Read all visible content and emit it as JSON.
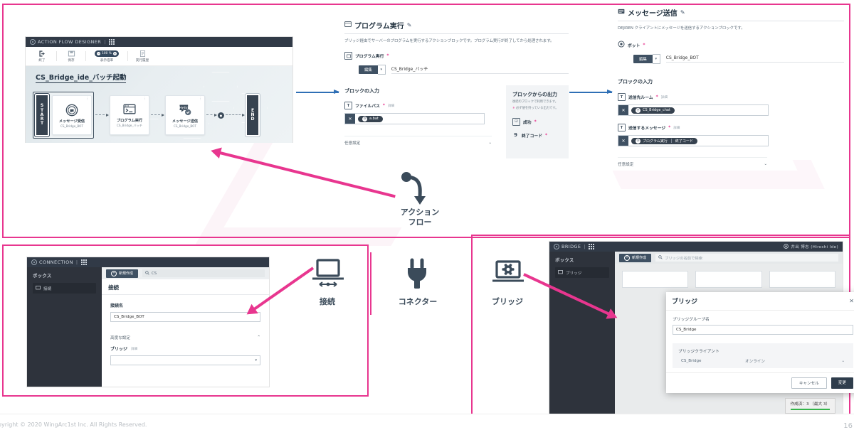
{
  "footer": {
    "copyright": "opyright © 2020 WingArc1st Inc.  All Rights Reserved.",
    "page_number": "16"
  },
  "center_labels": {
    "action_flow_line1": "アクション",
    "action_flow_line2": "フロー",
    "connection": "接続",
    "connector": "コネクター",
    "bridge": "ブリッジ"
  },
  "action_flow_designer": {
    "titlebar": "ACTION FLOW DESIGNER",
    "toolbar": [
      {
        "label": "終了",
        "icon": "exit-icon"
      },
      {
        "label": "保存",
        "icon": "save-icon"
      },
      {
        "label": "表示倍率",
        "icon": "zoom-control",
        "value": "100 %"
      },
      {
        "label": "実行履歴",
        "icon": "history-icon"
      }
    ],
    "flow_title": "CS_Bridge_ide_バッチ起動",
    "start_label": "START",
    "end_label": "END",
    "nodes": [
      {
        "name": "メッセージ受信",
        "sub": "CS_Bridge_BOT",
        "icon": "message-receive-icon"
      },
      {
        "name": "プログラム実行",
        "sub": "CS_Bridge_バッチ",
        "icon": "terminal-icon"
      },
      {
        "name": "メッセージ送信",
        "sub": "CS_Bridge_BOT",
        "icon": "message-send-icon"
      }
    ]
  },
  "program_panel": {
    "title": "プログラム実行",
    "description": "ブリッジ経由でサーバーのプログラムを実行するアクションブロックです。プログラム実行が終了してから処理されます。",
    "field_label": "プログラム実行",
    "edit_button": "編集",
    "edit_value": "CS_Bridge_バッチ",
    "input_section": "ブロックの入力",
    "file_path_label": "ファイルパス",
    "detail_link": "詳細",
    "file_path_value": "a.bat",
    "optional_settings": "任意設定",
    "output_section": "ブロックからの出力",
    "output_note1": "後続のブロックで利用できます。",
    "output_note2": "必ず値を持っている出力です。",
    "outputs": [
      {
        "label": "成功",
        "icon": "checkbox-icon"
      },
      {
        "label": "終了コード",
        "icon": "number-icon"
      }
    ]
  },
  "message_panel": {
    "title": "メッセージ送信",
    "description": "DEJIREN クライアントにメッセージを送信するアクションブロックです。",
    "bot_label": "ボット",
    "edit_button": "編集",
    "edit_value": "CS_Bridge_BOT",
    "input_section": "ブロックの入力",
    "room_label": "送信先ルーム",
    "detail_link": "詳細",
    "room_value": "CS_Bridge_chat",
    "message_label": "送信するメッセージ",
    "message_chip_source": "プログラム実行",
    "message_chip_field": "終了コード",
    "optional_settings": "任意設定"
  },
  "connection_window": {
    "titlebar": "CONNECTION",
    "sidebar_heading": "ボックス",
    "sidebar_item": "接続",
    "new_button": "新規作成",
    "search_value": "CS",
    "panel_header": "接続",
    "name_label": "接続名",
    "name_value": "CS_Bridge_BOT",
    "advanced_label": "高度な設定",
    "bridge_label": "ブリッジ",
    "bridge_detail": "詳細",
    "bridge_value": ""
  },
  "bridge_window": {
    "titlebar": "BRIDGE",
    "user": "井出 博志 (Hiroshi Ide)",
    "sidebar_heading": "ボックス",
    "sidebar_item": "ブリッジ",
    "new_button": "新規作成",
    "search_placeholder": "ブリッジの名前で検索",
    "count_badge": "作成済：3 （最大 3）",
    "modal": {
      "title": "ブリッジ",
      "group_name_label": "ブリッジグループ名",
      "group_name_value": "CS_Bridge",
      "client_label": "ブリッジクライアント",
      "client_name": "CS_Bridge",
      "client_status": "オンライン",
      "cancel_button": "キャンセル",
      "confirm_button": "変更"
    }
  },
  "colors": {
    "accent_pink": "#e8368f",
    "arrow_blue": "#2f6fb5",
    "dark_nav": "#2e333c",
    "status_green": "#35b54a"
  }
}
